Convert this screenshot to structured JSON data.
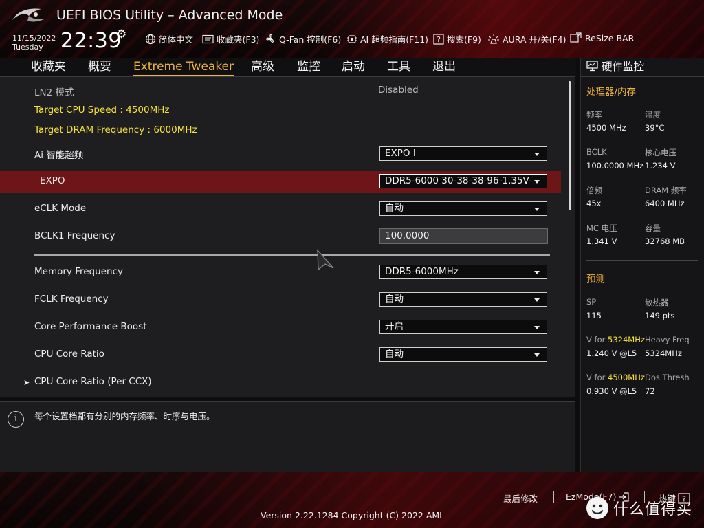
{
  "header": {
    "title": "UEFI BIOS Utility – Advanced Mode",
    "date": "11/15/2022",
    "day": "Tuesday",
    "time": "22:39",
    "toolbar": [
      {
        "label": "简体中文",
        "icon": "globe-icon"
      },
      {
        "label": "收藏夹(F3)",
        "icon": "bookmark-icon"
      },
      {
        "label": "Q-Fan 控制(F6)",
        "icon": "fan-icon"
      },
      {
        "label": "AI 超频指南(F11)",
        "icon": "ai-chip-icon"
      },
      {
        "label": "搜索(F9)",
        "icon": "search-help-icon"
      },
      {
        "label": "AURA 开/关(F4)",
        "icon": "aura-light-icon"
      },
      {
        "label": "ReSize BAR",
        "icon": "resize-bar-icon"
      }
    ]
  },
  "tabs": [
    {
      "label": "收藏夹",
      "active": false
    },
    {
      "label": "概要",
      "active": false
    },
    {
      "label": "Extreme Tweaker",
      "active": true
    },
    {
      "label": "高级",
      "active": false
    },
    {
      "label": "监控",
      "active": false
    },
    {
      "label": "启动",
      "active": false
    },
    {
      "label": "工具",
      "active": false
    },
    {
      "label": "退出",
      "active": false
    }
  ],
  "main": {
    "ln2_label": "LN2 模式",
    "ln2_value": "Disabled",
    "target_cpu": "Target CPU Speed : 4500MHz",
    "target_dram": "Target DRAM Frequency : 6000MHz",
    "rows": [
      {
        "label": "Ai 智能超频",
        "value": "EXPO I"
      },
      {
        "label": "EXPO",
        "value": "DDR5-6000 30-38-38-96-1.35V-"
      },
      {
        "label": "eCLK Mode",
        "value": "自动"
      },
      {
        "label": "BCLK1 Frequency",
        "value": "100.0000"
      },
      {
        "label": "Memory Frequency",
        "value": "DDR5-6000MHz"
      },
      {
        "label": "FCLK Frequency",
        "value": "自动"
      },
      {
        "label": "Core Performance Boost",
        "value": "开启"
      },
      {
        "label": "CPU Core Ratio",
        "value": "自动"
      }
    ],
    "submenu": "CPU Core Ratio (Per CCX)"
  },
  "help": {
    "text": "每个设置档都有分别的内存频率、时序与电压。"
  },
  "hw_monitor": {
    "title": "硬件监控",
    "cpu_mem_section": "处理器/内存",
    "cpu_mem": [
      {
        "label": "频率",
        "value": "4500 MHz"
      },
      {
        "label": "温度",
        "value": "39°C"
      },
      {
        "label": "BCLK",
        "value": "100.0000 MHz"
      },
      {
        "label": "核心电压",
        "value": "1.234 V"
      },
      {
        "label": "倍频",
        "value": "45x"
      },
      {
        "label": "DRAM 频率",
        "value": "6400 MHz"
      },
      {
        "label": "MC 电压",
        "value": "1.341 V"
      },
      {
        "label": "容量",
        "value": "32768 MB"
      }
    ],
    "predict_section": "预测",
    "sp_label": "SP",
    "sp_value": "115",
    "cooler_label": "散热器",
    "cooler_value": "149 pts",
    "v_for_prefix": "V for ",
    "v1_freq": "5324MHz",
    "v1_value": "1.240 V @L5",
    "heavy_label": "Heavy Freq",
    "heavy_value": "5324MHz",
    "v2_freq": "4500MHz",
    "v2_value": "0.930 V @L5",
    "dos_label": "Dos Thresh",
    "dos_value": "72"
  },
  "footer": {
    "last_modified": "最后修改",
    "ezmode": "EzMode(F7)",
    "hotkeys": "热键",
    "version": "Version 2.22.1284 Copyright (C) 2022 AMI",
    "watermark": "什么值得买"
  },
  "colors": {
    "accent": "#f2b33a",
    "highlight_row": "#6e1518",
    "target_text": "#f5e23a"
  }
}
